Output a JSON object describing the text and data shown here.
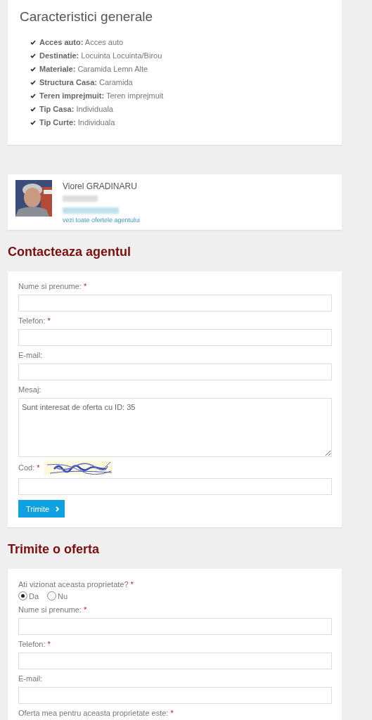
{
  "characteristics": {
    "title": "Caracteristici generale",
    "items": [
      {
        "label": "Acces auto:",
        "value": "Acces auto"
      },
      {
        "label": "Destinatie:",
        "value": "Locuinta Locuinta/Birou"
      },
      {
        "label": "Materiale:",
        "value": "Caramida Lemn Alte"
      },
      {
        "label": "Structura Casa:",
        "value": "Caramida"
      },
      {
        "label": "Teren imprejmuit:",
        "value": "Teren imprejmuit"
      },
      {
        "label": "Tip Casa:",
        "value": "Individuala"
      },
      {
        "label": "Tip Curte:",
        "value": "Individuala"
      }
    ]
  },
  "agent": {
    "name": "Viorel GRADINARU",
    "link": "vezi toate ofertele agentului"
  },
  "contact": {
    "heading": "Contacteaza agentul",
    "fields": [
      {
        "kind": "input",
        "label": "Nume si prenume:",
        "mark": "*"
      },
      {
        "kind": "input",
        "label": "Telefon:",
        "mark": "*"
      },
      {
        "kind": "input",
        "label": "E-mail:"
      },
      {
        "kind": "textarea",
        "label": "Mesaj:",
        "value": "Sunt interesat de oferta cu ID: 35"
      },
      {
        "kind": "captcha",
        "label": "Cod:",
        "mark": "*"
      }
    ],
    "submit": "Trimite"
  },
  "offer": {
    "heading": "Trimite o oferta",
    "question": {
      "label": "Ati vizionat aceasta proprietate?",
      "mark": "*",
      "options": [
        {
          "label": "Da",
          "selected": true
        },
        {
          "label": "Nu",
          "selected": false
        }
      ]
    },
    "fields": [
      {
        "kind": "input",
        "label": "Nume si prenume:",
        "mark": "*"
      },
      {
        "kind": "input",
        "label": "Telefon:",
        "mark": "*"
      },
      {
        "kind": "input",
        "label": "E-mail:"
      },
      {
        "kind": "label",
        "label": "Oferta mea pentru aceasta proprietate este:",
        "mark": "*"
      }
    ]
  }
}
